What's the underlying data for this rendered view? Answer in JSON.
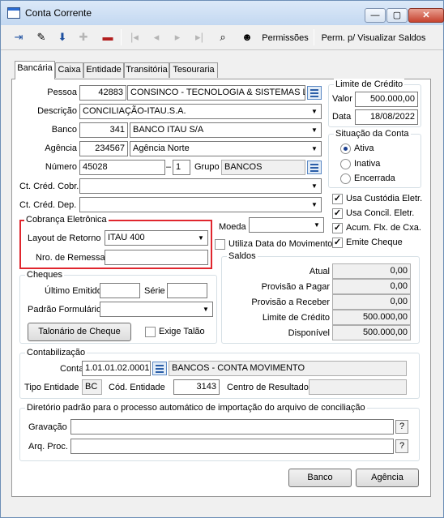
{
  "window": {
    "title": "Conta Corrente",
    "minimize": "—",
    "maximize": "▢",
    "close": "✕"
  },
  "toolbar": {
    "permissoes": "Permissões",
    "perm_visualizar": "Perm. p/ Visualizar Saldos"
  },
  "tabs": [
    "Bancária",
    "Caixa",
    "Entidade",
    "Transitória",
    "Tesouraria"
  ],
  "form": {
    "pessoa": {
      "label": "Pessoa",
      "code": "42883",
      "name": "CONSINCO - TECNOLOGIA & SISTEMAS LT"
    },
    "descricao": {
      "label": "Descrição",
      "value": "CONCILIAÇÃO-ITAU.S.A."
    },
    "banco": {
      "label": "Banco",
      "code": "341",
      "name": "BANCO ITAU S/A"
    },
    "agencia": {
      "label": "Agência",
      "code": "234567",
      "name": "Agência Norte"
    },
    "numero": {
      "label": "Número",
      "value": "45028",
      "sep": "–",
      "digito": "1"
    },
    "grupo": {
      "label": "Grupo",
      "value": "BANCOS"
    },
    "ct_cred_cobr": {
      "label": "Ct. Créd. Cobr.",
      "value": ""
    },
    "ct_cred_dep": {
      "label": "Ct. Créd. Dep.",
      "value": ""
    }
  },
  "limite_credito": {
    "title": "Limite de Crédito",
    "valor_label": "Valor",
    "valor": "500.000,00",
    "data_label": "Data",
    "data": "18/08/2022"
  },
  "situacao": {
    "title": "Situação da Conta",
    "options": [
      "Ativa",
      "Inativa",
      "Encerrada"
    ],
    "selected": "Ativa"
  },
  "flags": [
    {
      "label": "Usa Custódia Eletr.",
      "checked": true
    },
    {
      "label": "Usa Concil. Eletr.",
      "checked": true
    },
    {
      "label": "Acum. Flx. de Cxa.",
      "checked": true
    },
    {
      "label": "Emite Cheque",
      "checked": true
    }
  ],
  "cobranca": {
    "title": "Cobrança Eletrônica",
    "layout_label": "Layout de Retorno",
    "layout_value": "ITAU 400",
    "remessa_label": "Nro. de Remessa",
    "remessa_value": ""
  },
  "moeda": {
    "label": "Moeda",
    "value": ""
  },
  "utiliza_data": {
    "label": "Utiliza Data do Movimento",
    "checked": false
  },
  "cheques": {
    "title": "Cheques",
    "ultimo_label": "Último Emitido",
    "ultimo_value": "",
    "serie_label": "Série",
    "serie_value": "",
    "padrao_label": "Padrão Formulário",
    "padrao_value": "",
    "talonario_button": "Talonário de Cheque",
    "exige_label": "Exige Talão",
    "exige_checked": false
  },
  "saldos": {
    "title": "Saldos",
    "rows": [
      {
        "label": "Atual",
        "value": "0,00"
      },
      {
        "label": "Provisão a Pagar",
        "value": "0,00"
      },
      {
        "label": "Provisão a Receber",
        "value": "0,00"
      },
      {
        "label": "Limite de Crédito",
        "value": "500.000,00"
      },
      {
        "label": "Disponível",
        "value": "500.000,00"
      }
    ]
  },
  "contabilizacao": {
    "title": "Contabilização",
    "conta_label": "Conta",
    "conta_value": "1.01.01.02.0001",
    "conta_desc": "BANCOS - CONTA MOVIMENTO",
    "tipo_label": "Tipo Entidade",
    "tipo_value": "BC",
    "cod_label": "Cód. Entidade",
    "cod_value": "3143",
    "centro_label": "Centro de Resultado",
    "centro_value": ""
  },
  "diretorio": {
    "title": "Diretório padrão para o processo automático de importação do arquivo de conciliação",
    "gravacao_label": "Gravação",
    "gravacao_value": "",
    "arq_label": "Arq. Proc.",
    "arq_value": "",
    "help": "?"
  },
  "footer": {
    "banco_button": "Banco",
    "agencia_button": "Agência"
  }
}
